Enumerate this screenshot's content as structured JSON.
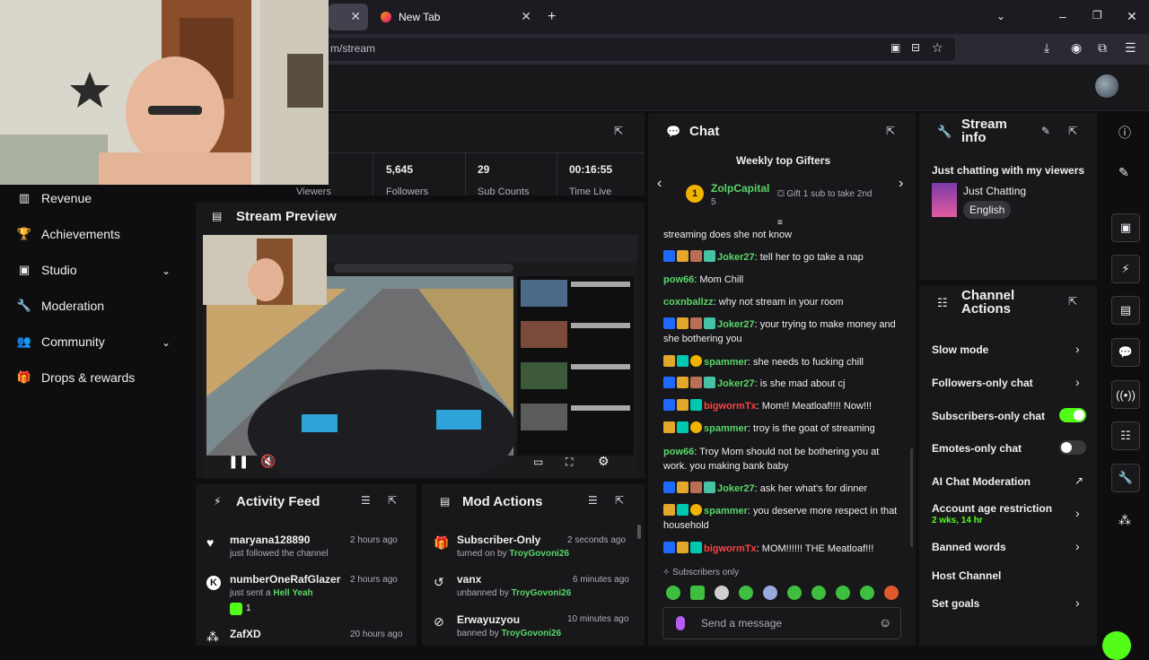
{
  "browser": {
    "tabs": [
      {
        "label": "New Tab"
      }
    ],
    "url_suffix": "m/stream"
  },
  "sidebar": {
    "items": [
      {
        "label": "Revenue",
        "icon": "chart-icon",
        "expandable": false
      },
      {
        "label": "Achievements",
        "icon": "trophy-icon",
        "expandable": false
      },
      {
        "label": "Studio",
        "icon": "camera-icon",
        "expandable": true
      },
      {
        "label": "Moderation",
        "icon": "wrench-icon",
        "expandable": false
      },
      {
        "label": "Community",
        "icon": "people-icon",
        "expandable": true
      },
      {
        "label": "Drops & rewards",
        "icon": "gift-icon",
        "expandable": false
      }
    ]
  },
  "stats": [
    {
      "value": "5,645",
      "label": "Followers"
    },
    {
      "value": "29",
      "label": "Sub Counts"
    },
    {
      "value": "00:16:55",
      "label": "Time Live"
    },
    {
      "value": "",
      "label": "Viewers"
    }
  ],
  "stream_preview": {
    "title": "Stream Preview"
  },
  "chat": {
    "title": "Chat",
    "gifters_title": "Weekly top Gifters",
    "top_gifter": {
      "rank": "1",
      "name": "ZolpCapital",
      "count": "5"
    },
    "gift_note": "Gift 1 sub to take 2nd",
    "messages": [
      {
        "user": "",
        "text": "streaming does she not know",
        "color": "none"
      },
      {
        "user": "Joker27",
        "text": "tell her to go take a nap",
        "color": "green"
      },
      {
        "user": "pow66",
        "text": "Mom Chill",
        "color": "green"
      },
      {
        "user": "coxnballzz",
        "text": "why not stream in your room",
        "color": "green"
      },
      {
        "user": "Joker27",
        "text": "your trying to make money and she bothering you",
        "color": "green"
      },
      {
        "user": "spammer",
        "text": "she needs to fucking chill",
        "color": "green"
      },
      {
        "user": "Joker27",
        "text": "is she mad about cj",
        "color": "green"
      },
      {
        "user": "bigwormTx",
        "text": "Mom!! Meatloaf!!!! Now!!!",
        "color": "red"
      },
      {
        "user": "spammer",
        "text": "troy is the goat of streaming",
        "color": "green"
      },
      {
        "user": "pow66",
        "text": "Troy Mom should not be bothering you at work. you making bank baby",
        "color": "green"
      },
      {
        "user": "Joker27",
        "text": "ask her what's for dinner",
        "color": "green"
      },
      {
        "user": "spammer",
        "text": "you deserve more respect in that household",
        "color": "green"
      },
      {
        "user": "bigwormTx",
        "text": "MOM!!!!!! THE Meatloaf!!!",
        "color": "red"
      }
    ],
    "subscribers_only": "Subscribers only",
    "input_placeholder": "Send a message"
  },
  "stream_info": {
    "title": "Stream info",
    "stream_title": "Just chatting with my viewers",
    "category": "Just Chatting",
    "language": "English"
  },
  "channel_actions": {
    "title": "Channel Actions",
    "items": [
      {
        "label": "Slow mode",
        "control": "chevron"
      },
      {
        "label": "Followers-only chat",
        "control": "chevron"
      },
      {
        "label": "Subscribers-only chat",
        "control": "toggle-on"
      },
      {
        "label": "Emotes-only chat",
        "control": "toggle-off"
      },
      {
        "label": "AI Chat Moderation",
        "control": "external"
      },
      {
        "label": "Account age restriction",
        "sub": "2 wks, 14 hr",
        "control": "chevron"
      },
      {
        "label": "Banned words",
        "control": "chevron"
      },
      {
        "label": "Host Channel",
        "control": "none"
      },
      {
        "label": "Set goals",
        "control": "chevron"
      }
    ]
  },
  "activity_feed": {
    "title": "Activity Feed",
    "items": [
      {
        "name": "maryana128890",
        "sub": "just followed the channel",
        "time": "2 hours ago",
        "icon": "heart-icon"
      },
      {
        "name": "numberOneRafGlazer",
        "sub": "just sent a",
        "sub_link": "Hell Yeah",
        "extra": "1",
        "time": "2 hours ago",
        "icon": "kick-icon"
      },
      {
        "name": "ZafXD",
        "sub": "",
        "time": "20 hours ago",
        "icon": "raid-icon"
      }
    ]
  },
  "mod_actions": {
    "title": "Mod Actions",
    "items": [
      {
        "name": "Subscriber-Only",
        "sub": "turned on by",
        "by": "TroyGovoni26",
        "time": "2 seconds ago",
        "icon": "gift-icon"
      },
      {
        "name": "vanx",
        "sub": "unbanned by",
        "by": "TroyGovoni26",
        "time": "6 minutes ago",
        "icon": "undo-icon"
      },
      {
        "name": "Erwayuzyou",
        "sub": "banned by",
        "by": "TroyGovoni26",
        "time": "10 minutes ago",
        "icon": "ban-icon"
      }
    ]
  },
  "colors": {
    "accent": "#53fc18",
    "panel": "#18181b",
    "bg": "#0e0e10",
    "green_user": "#5ad667",
    "red_user": "#ff4040"
  }
}
